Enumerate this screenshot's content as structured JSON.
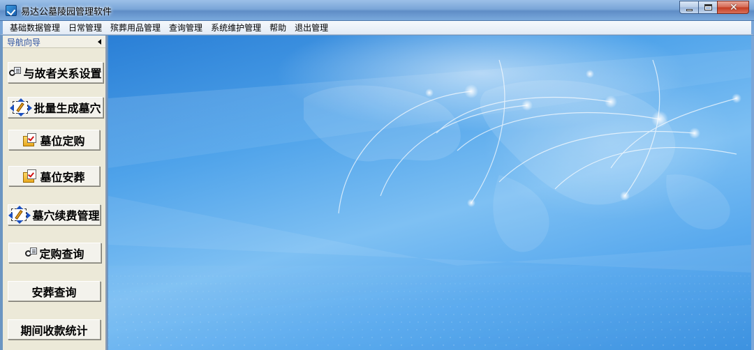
{
  "window": {
    "title": "易达公墓陵园管理软件",
    "app_icon": "check-app-icon",
    "close_symbol": "✕"
  },
  "menu": {
    "items": [
      {
        "label": "基础数据管理"
      },
      {
        "label": "日常管理"
      },
      {
        "label": "殡葬用品管理"
      },
      {
        "label": "查询管理"
      },
      {
        "label": "系统维护管理"
      },
      {
        "label": "帮助"
      },
      {
        "label": "退出管理"
      }
    ]
  },
  "nav": {
    "header": "导航向导",
    "buttons": [
      {
        "label": "与故者关系设置",
        "icon": "link-icon"
      },
      {
        "label": "批量生成墓穴",
        "icon": "edit-frame-icon"
      },
      {
        "label": "墓位定购",
        "icon": "folder-check-icon"
      },
      {
        "label": "墓位安葬",
        "icon": "folder-check-icon"
      },
      {
        "label": "墓穴续费管理",
        "icon": "edit-frame-icon"
      },
      {
        "label": "定购查询",
        "icon": "link-icon"
      },
      {
        "label": "安葬查询",
        "icon": ""
      },
      {
        "label": "期间收款统计",
        "icon": ""
      }
    ]
  },
  "colors": {
    "titlebar": "#7aa6d8",
    "nav_bg": "#ece9d8",
    "main_bg": "#4fa3ea"
  }
}
